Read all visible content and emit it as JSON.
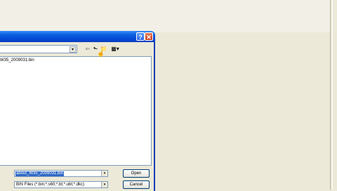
{
  "dialog": {
    "help_glyph": "?",
    "close_glyph": "✕",
    "file_item": "W35_2009031.bin",
    "filename_value": "about_W35_2009031.bin",
    "filetype_value": "BIN Files (*.bin;*.s60;*.bt;*.ubt;*.dkc)",
    "open_label": "Open",
    "cancel_label": "Cancel",
    "dropdown_glyph": "▾"
  },
  "toolbar": {
    "back_icon": "⇐",
    "up_icon": "⬑",
    "newfolder_icon": "📁",
    "views_icon": "▦▾"
  },
  "colors": {
    "titlebar": "#0a5ee0",
    "selection": "#316ac5"
  }
}
